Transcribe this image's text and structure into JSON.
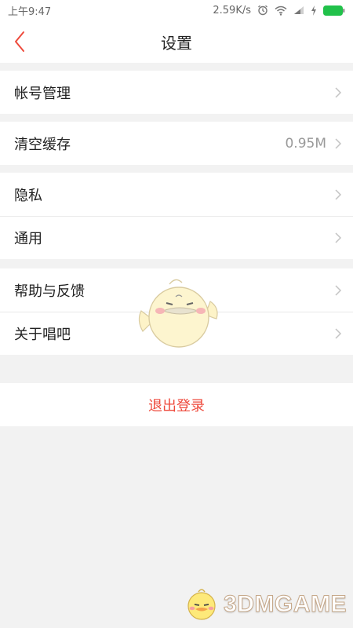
{
  "status_bar": {
    "time": "上午9:47",
    "network_speed": "2.59K/s",
    "icons": [
      "alarm-icon",
      "wifi-icon",
      "signal-icon",
      "charging-icon",
      "battery-icon"
    ],
    "battery_color": "#21c14a"
  },
  "navbar": {
    "title": "设置",
    "back_icon": "chevron-left-icon",
    "accent": "#ee4a3c"
  },
  "settings": {
    "groups": [
      {
        "items": [
          {
            "label": "帐号管理"
          }
        ]
      },
      {
        "items": [
          {
            "label": "清空缓存",
            "value": "0.95M"
          }
        ]
      },
      {
        "items": [
          {
            "label": "隐私"
          },
          {
            "label": "通用"
          }
        ]
      },
      {
        "items": [
          {
            "label": "帮助与反馈"
          },
          {
            "label": "关于唱吧"
          }
        ]
      }
    ]
  },
  "logout": {
    "label": "退出登录",
    "color": "#ee4a3c"
  },
  "watermark": {
    "text": "3DMGAME"
  }
}
